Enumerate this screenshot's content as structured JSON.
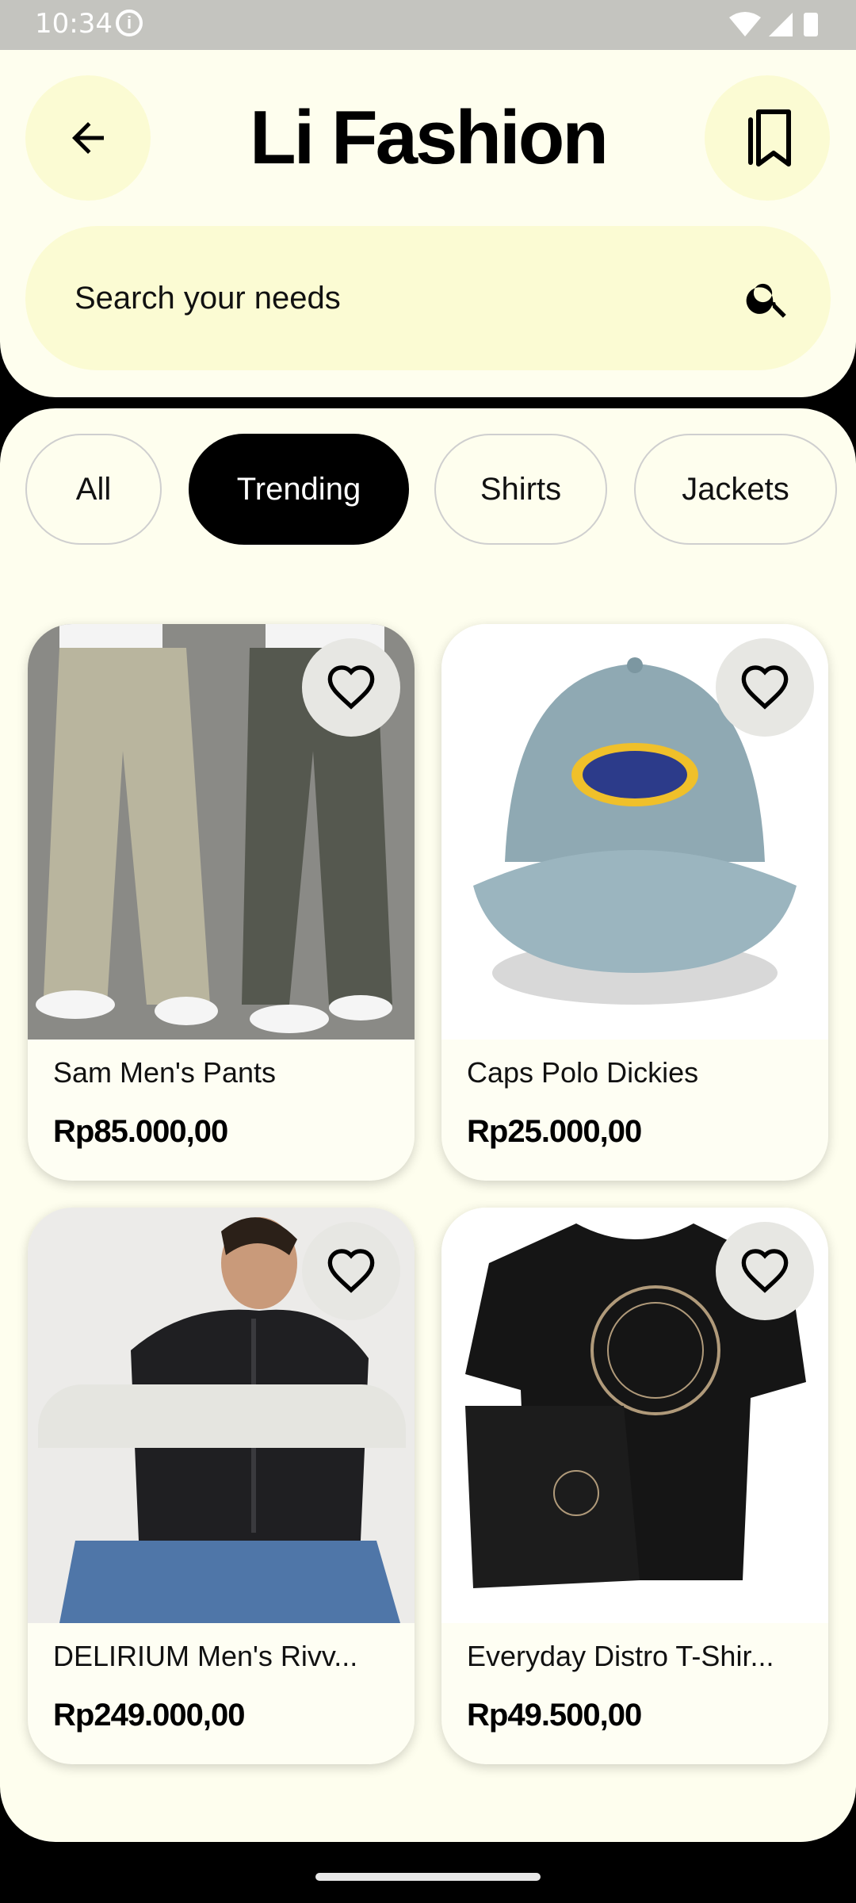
{
  "status_bar": {
    "time": "10:34"
  },
  "header": {
    "title": "Li Fashion",
    "search_placeholder": "Search your needs"
  },
  "chips": [
    {
      "label": "All",
      "active": false
    },
    {
      "label": "Trending",
      "active": true
    },
    {
      "label": "Shirts",
      "active": false
    },
    {
      "label": "Jackets",
      "active": false
    }
  ],
  "products": [
    {
      "name": "Sam Men's Pants",
      "price": "Rp85.000,00",
      "image": "pants-photo"
    },
    {
      "name": "Caps Polo Dickies",
      "price": "Rp25.000,00",
      "image": "cap-photo"
    },
    {
      "name": "DELIRIUM Men's Rivv...",
      "price": "Rp249.000,00",
      "image": "jacket-photo"
    },
    {
      "name": "Everyday Distro T-Shir...",
      "price": "Rp49.500,00",
      "image": "tshirt-photo"
    }
  ],
  "colors": {
    "background": "#fefeee",
    "accent": "#fbfbd3",
    "active_chip": "#000000"
  }
}
